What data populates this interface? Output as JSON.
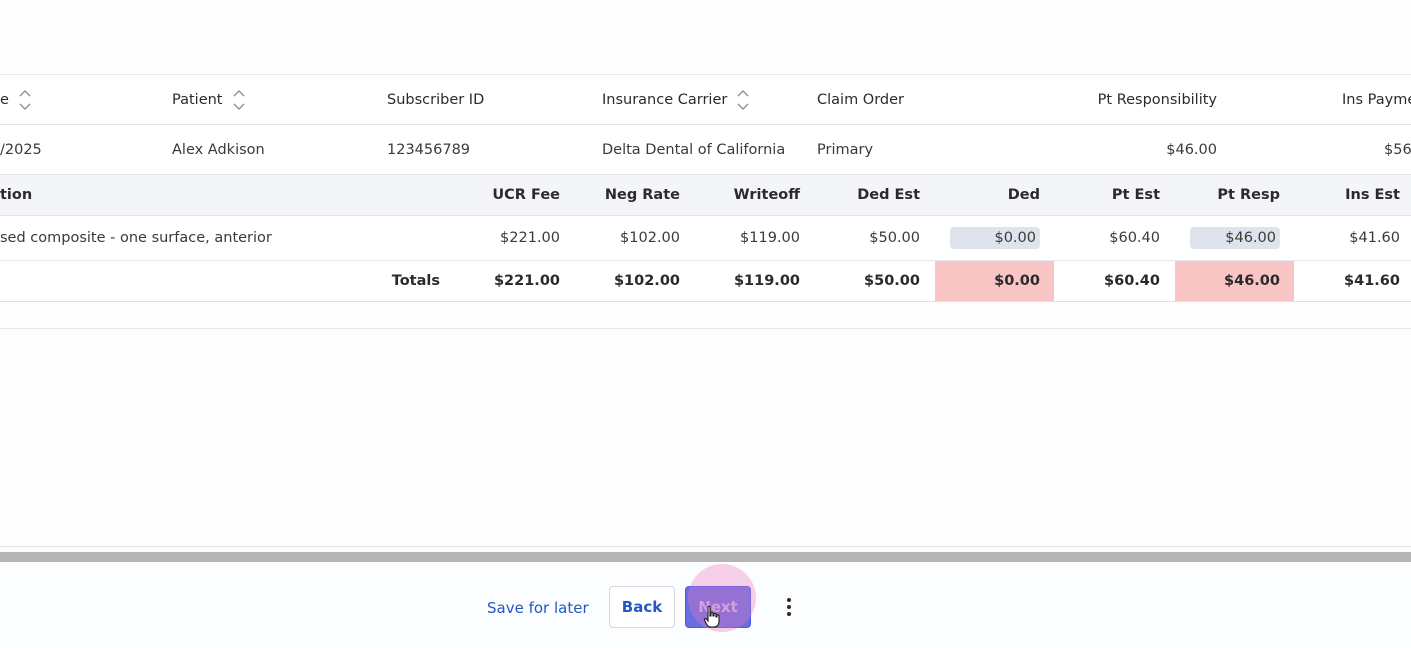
{
  "claim_table": {
    "headers": {
      "date": "e",
      "patient": "Patient",
      "subscriber_id": "Subscriber ID",
      "insurance_carrier": "Insurance Carrier",
      "claim_order": "Claim Order",
      "pt_responsibility": "Pt Responsibility",
      "ins_payment": "Ins Payme"
    },
    "row": {
      "date": "/2025",
      "patient": "Alex Adkison",
      "subscriber_id": "123456789",
      "insurance_carrier": "Delta Dental of California",
      "claim_order": "Primary",
      "pt_responsibility": "$46.00",
      "ins_payment": "$56"
    }
  },
  "procedure_table": {
    "headers": {
      "description": "tion",
      "ucr_fee": "UCR Fee",
      "neg_rate": "Neg Rate",
      "writeoff": "Writeoff",
      "ded_est": "Ded Est",
      "ded": "Ded",
      "pt_est": "Pt Est",
      "pt_resp": "Pt Resp",
      "ins_est": "Ins Est"
    },
    "rows": [
      {
        "description": "sed composite - one surface, anterior",
        "ucr_fee": "$221.00",
        "neg_rate": "$102.00",
        "writeoff": "$119.00",
        "ded_est": "$50.00",
        "ded": "$0.00",
        "pt_est": "$60.40",
        "pt_resp": "$46.00",
        "ins_est": "$41.60"
      }
    ],
    "totals": {
      "label": "Totals",
      "ucr_fee": "$221.00",
      "neg_rate": "$102.00",
      "writeoff": "$119.00",
      "ded_est": "$50.00",
      "ded": "$0.00",
      "pt_est": "$60.40",
      "pt_resp": "$46.00",
      "ins_est": "$41.60"
    }
  },
  "footer": {
    "save_for_later": "Save for later",
    "back": "Back",
    "next": "Next"
  },
  "icons": {
    "sort": "sort-icon",
    "more": "kebab-menu-icon",
    "cursor": "hand-pointer-icon"
  },
  "colors": {
    "link": "#2557c7",
    "primary_button": "#6a6de0",
    "highlight_cell": "#f8c4c4",
    "pill_bg": "#dfe4ec",
    "header_bg": "#f3f5f8"
  }
}
